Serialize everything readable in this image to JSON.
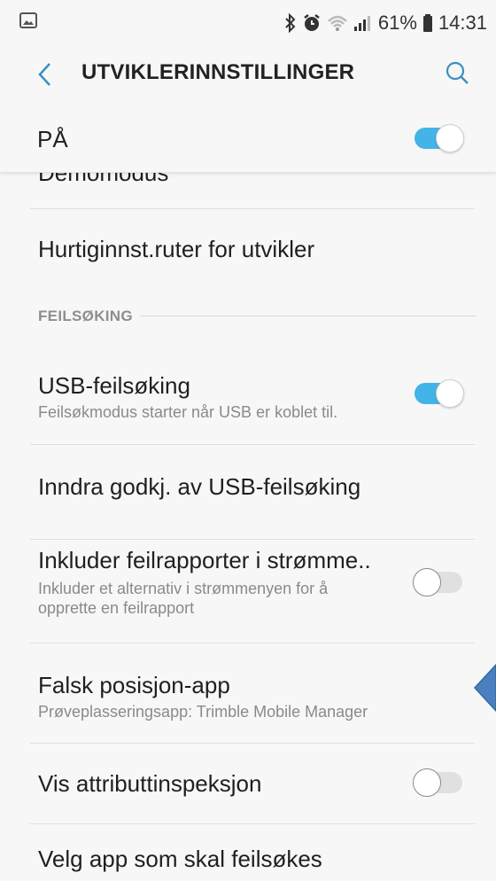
{
  "status": {
    "battery": "61%",
    "time": "14:31",
    "left_icon": "image-icon",
    "icons": [
      "bluetooth-icon",
      "alarm-icon",
      "wifi-icon",
      "signal-icon",
      "battery-icon"
    ]
  },
  "appbar": {
    "title": "UTVIKLERINNSTILLINGER",
    "back_icon": "back-arrow-icon",
    "search_icon": "search-icon"
  },
  "master": {
    "label": "PÅ",
    "enabled": true
  },
  "items": {
    "demomodus": {
      "title": "Demomodus"
    },
    "quick_tiles": {
      "title": "Hurtiginnst.ruter for utvikler"
    },
    "section": {
      "header": "FEILSØKING"
    },
    "usb_debugging": {
      "title": "USB-feilsøking",
      "subtitle": "Feilsøkmodus starter når USB er koblet til.",
      "enabled": true
    },
    "revoke_usb": {
      "title": "Inndra godkj. av USB-feilsøking"
    },
    "bug_report": {
      "title": "Inkluder feilrapporter i strømme..",
      "subtitle": "Inkluder et alternativ i strømmenyen for å opprette en feilrapport",
      "enabled": false
    },
    "mock_location": {
      "title": "Falsk posisjon-app",
      "subtitle": "Prøveplasseringsapp: Trimble Mobile Manager"
    },
    "attr_inspection": {
      "title": "Vis attributtinspeksjon",
      "enabled": false
    },
    "debug_app": {
      "title": "Velg app som skal feilsøkes"
    }
  },
  "colors": {
    "accent": "#42b4e8",
    "annotation_arrow": "#4a7fc0"
  }
}
